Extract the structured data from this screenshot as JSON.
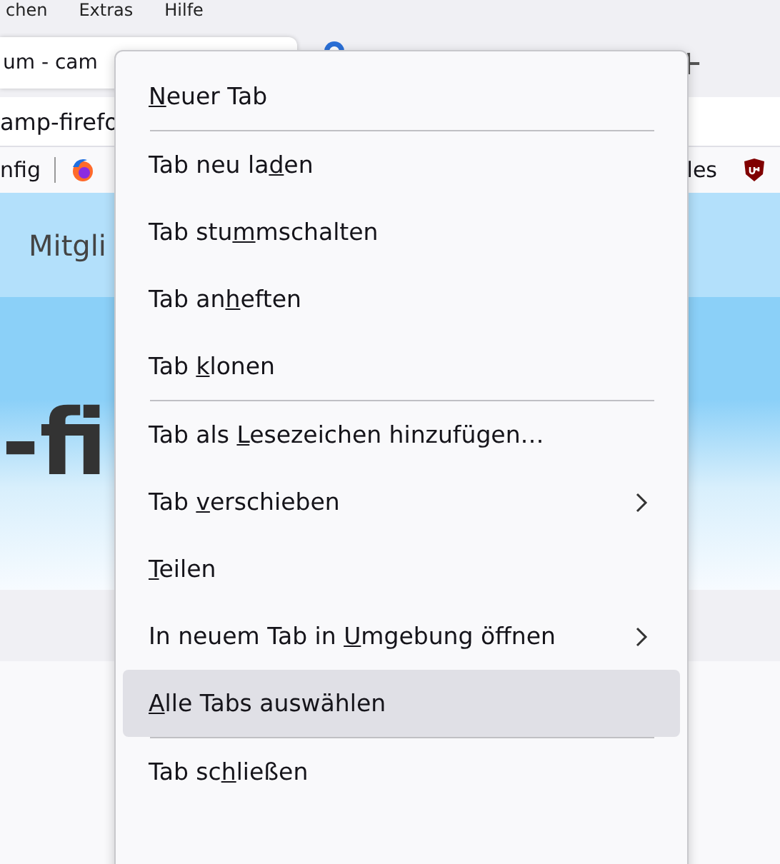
{
  "menubar": [
    "chen",
    "Extras",
    "Hilfe"
  ],
  "tabs": [
    {
      "label": "um - cam",
      "selected": true
    },
    {
      "selected": false
    }
  ],
  "new_tab_button": "+",
  "address": "amp-firefo",
  "bookmarks": [
    {
      "label": "nfig",
      "kind": "text"
    },
    {
      "kind": "firefox"
    },
    {
      "label": "les",
      "kind": "text"
    },
    {
      "kind": "shield"
    }
  ],
  "page": {
    "nav_item": "Mitgli",
    "banner_title": "-fi"
  },
  "context_menu": [
    {
      "kind": "item",
      "key": "N",
      "after": "euer Tab",
      "selected": false
    },
    {
      "kind": "separator"
    },
    {
      "kind": "item",
      "before": "Tab neu la",
      "key": "d",
      "after": "en",
      "selected": false
    },
    {
      "kind": "item",
      "before": "Tab stu",
      "key": "m",
      "after": "mschalten",
      "selected": false
    },
    {
      "kind": "item",
      "before": "Tab an",
      "key": "h",
      "after": "eften",
      "selected": false
    },
    {
      "kind": "item",
      "before": "Tab ",
      "key": "k",
      "after": "lonen",
      "selected": false
    },
    {
      "kind": "separator"
    },
    {
      "kind": "item",
      "before": "Tab als ",
      "key": "L",
      "after": "esezeichen hinzufügen…",
      "selected": false
    },
    {
      "kind": "submenu",
      "before": "Tab ",
      "key": "v",
      "after": "erschieben",
      "selected": false
    },
    {
      "kind": "item",
      "key": "T",
      "after": "eilen",
      "selected": false
    },
    {
      "kind": "submenu",
      "before": "In neuem Tab in ",
      "key": "U",
      "after": "mgebung öffnen",
      "selected": false
    },
    {
      "kind": "item",
      "key": "A",
      "after": "lle Tabs auswählen",
      "selected": true
    },
    {
      "kind": "separator"
    },
    {
      "kind": "item",
      "before": "Tab sc",
      "key": "h",
      "after": "ließen",
      "selected": false
    }
  ]
}
